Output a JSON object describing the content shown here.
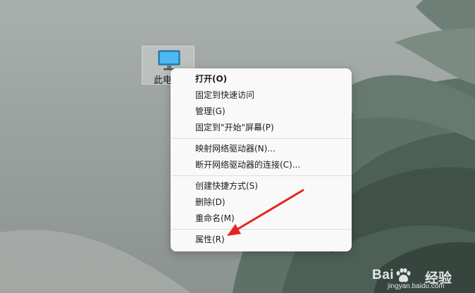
{
  "desktop": {
    "this_pc_label": "此电脑"
  },
  "context_menu": {
    "groups": [
      [
        {
          "label": "打开(O)",
          "bold": true
        },
        {
          "label": "固定到快速访问"
        },
        {
          "label": "管理(G)"
        },
        {
          "label": "固定到\"开始\"屏幕(P)"
        }
      ],
      [
        {
          "label": "映射网络驱动器(N)..."
        },
        {
          "label": "断开网络驱动器的连接(C)..."
        }
      ],
      [
        {
          "label": "创建快捷方式(S)"
        },
        {
          "label": "删除(D)"
        },
        {
          "label": "重命名(M)"
        }
      ],
      [
        {
          "label": "属性(R)"
        }
      ]
    ]
  },
  "watermark": {
    "brand": "Bai",
    "brand_suffix": "经验",
    "url": "jingyan.baidu.com"
  },
  "colors": {
    "annotation_arrow": "#e8231f",
    "menu_background": "#f9f9f9"
  }
}
